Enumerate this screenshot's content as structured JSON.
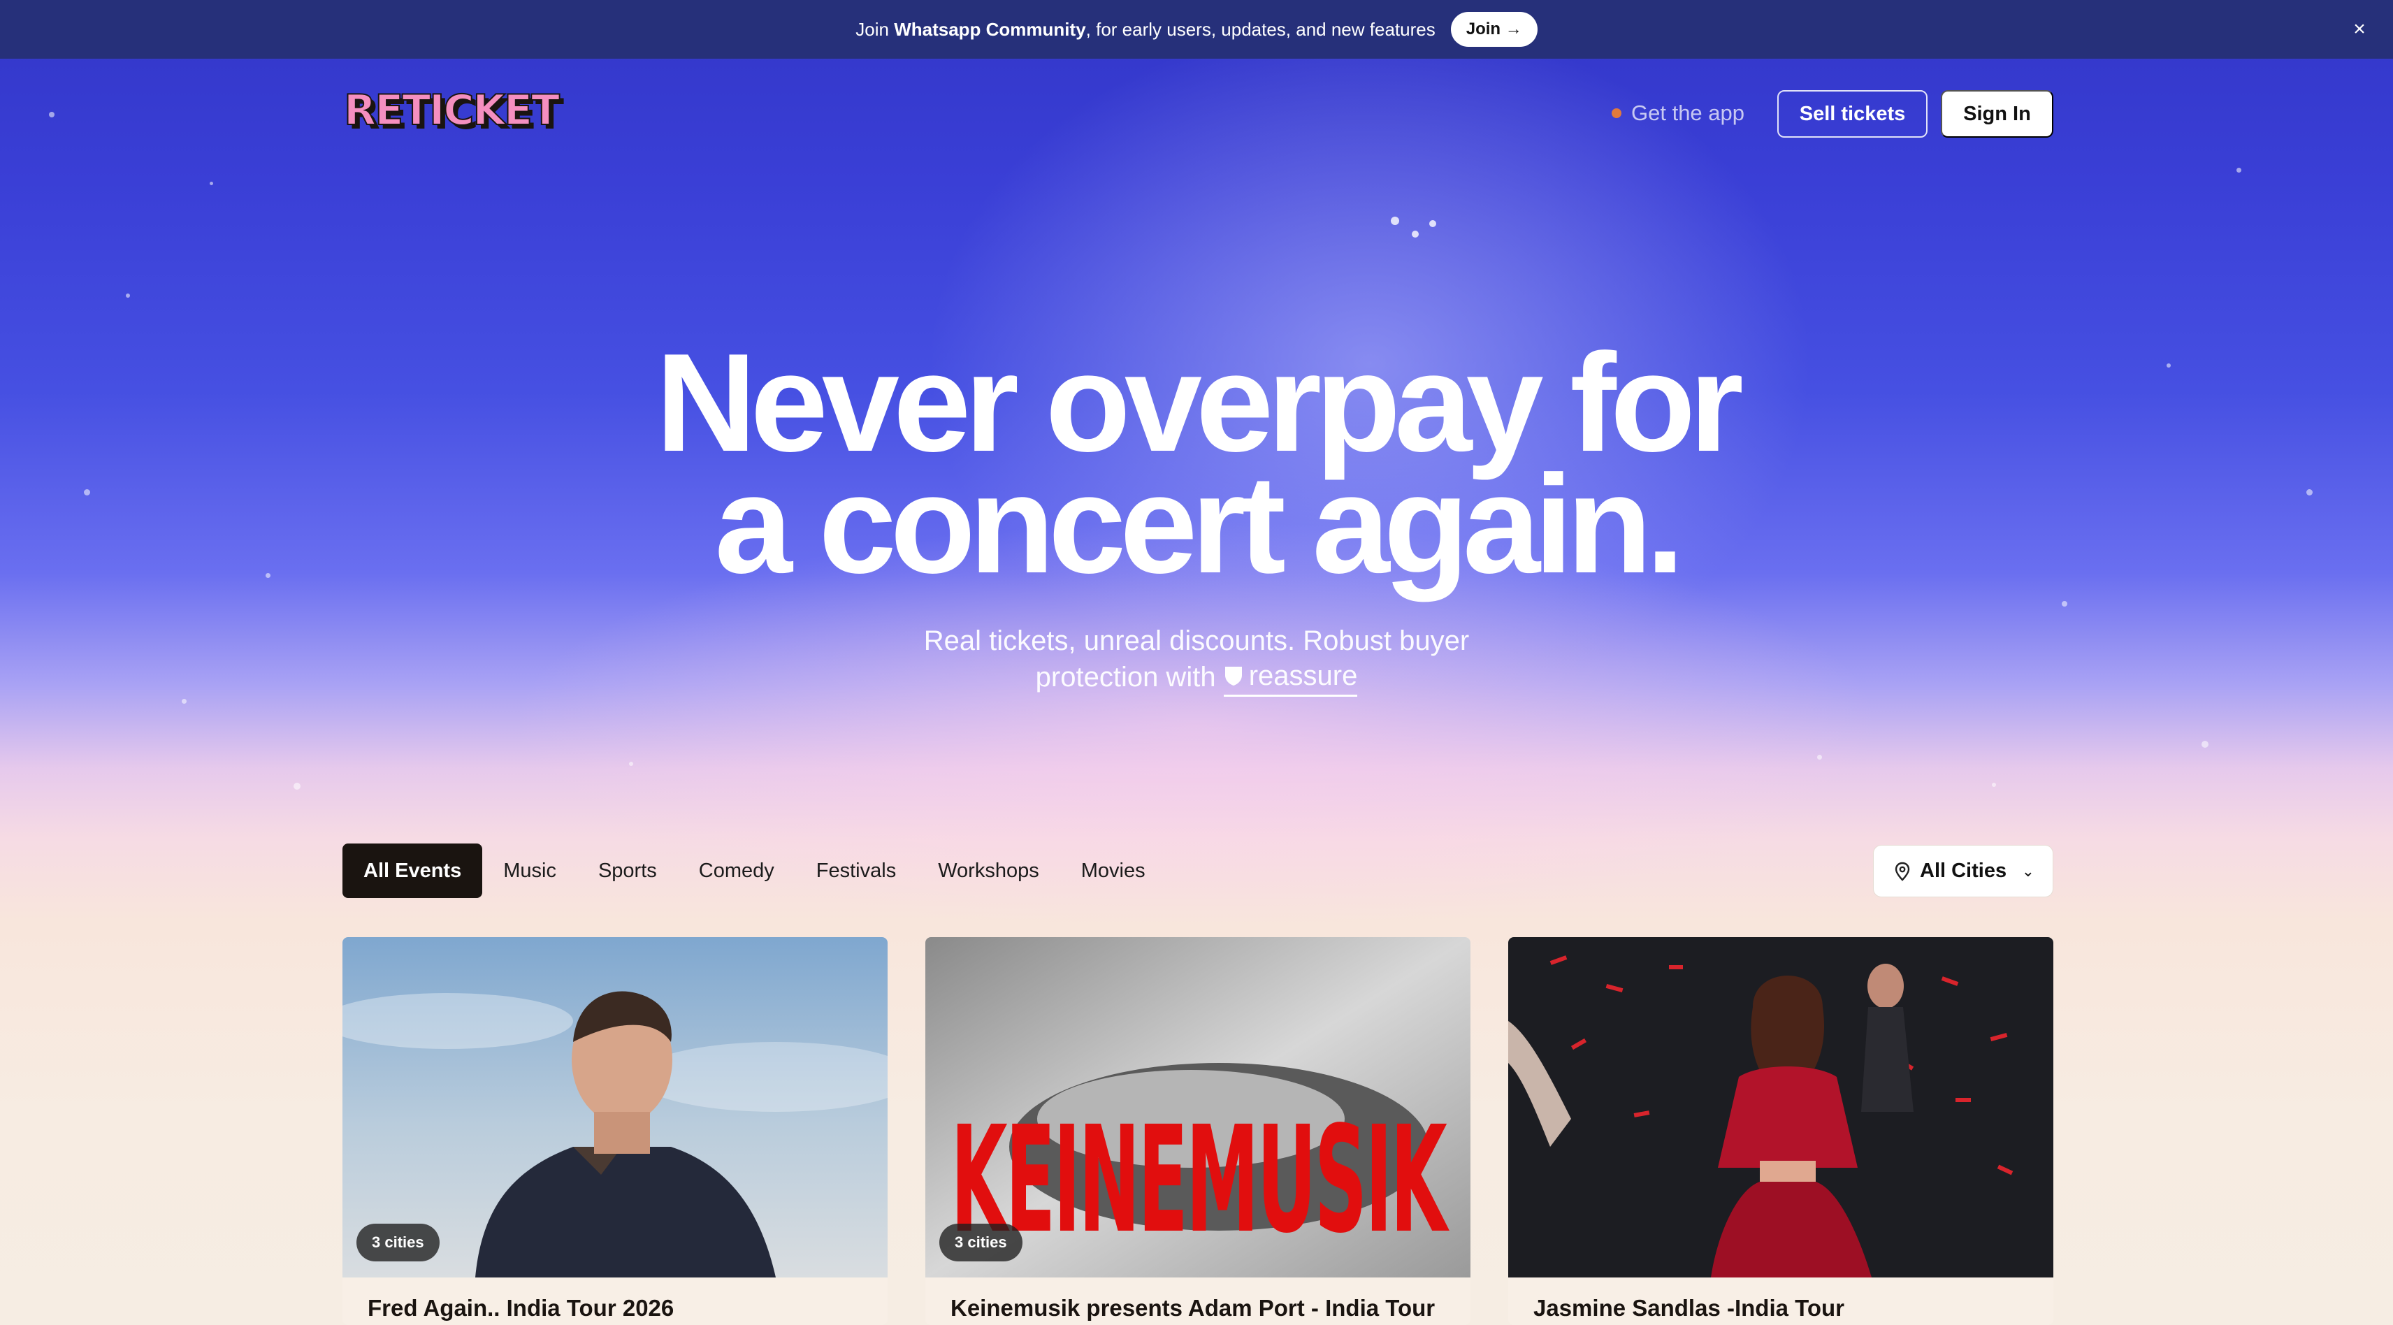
{
  "banner": {
    "prefix": "Join ",
    "bold": "Whatsapp Community",
    "suffix": ", for early users, updates, and new features",
    "join_label": "Join →",
    "close_glyph": "×"
  },
  "header": {
    "logo_text": "RETICKET",
    "get_app_label": "Get the app",
    "sell_label": "Sell tickets",
    "signin_label": "Sign In"
  },
  "hero": {
    "title_line1": "Never overpay for",
    "title_line2": "a concert again.",
    "subtitle_line1": "Real tickets, unreal discounts. Robust buyer",
    "subtitle_line2_prefix": "protection with",
    "reassure_label": "reassure"
  },
  "filters": {
    "tabs": [
      {
        "label": "All Events",
        "active": true
      },
      {
        "label": "Music",
        "active": false
      },
      {
        "label": "Sports",
        "active": false
      },
      {
        "label": "Comedy",
        "active": false
      },
      {
        "label": "Festivals",
        "active": false
      },
      {
        "label": "Workshops",
        "active": false
      },
      {
        "label": "Movies",
        "active": false
      }
    ],
    "city_label": "All Cities"
  },
  "cards": [
    {
      "title": "Fred Again.. India Tour 2026",
      "badge": "3 cities"
    },
    {
      "title": "Keinemusik presents Adam Port - India Tour",
      "badge": "3 cities",
      "art_text": "KEINEMUSIK"
    },
    {
      "title": "Jasmine Sandlas -India Tour",
      "badge": ""
    }
  ],
  "colors": {
    "banner_bg": "#26307a",
    "hero_blue": "#3a3fd6",
    "active_tab_bg": "#1a1410",
    "logo_pink": "#f58fc0"
  }
}
